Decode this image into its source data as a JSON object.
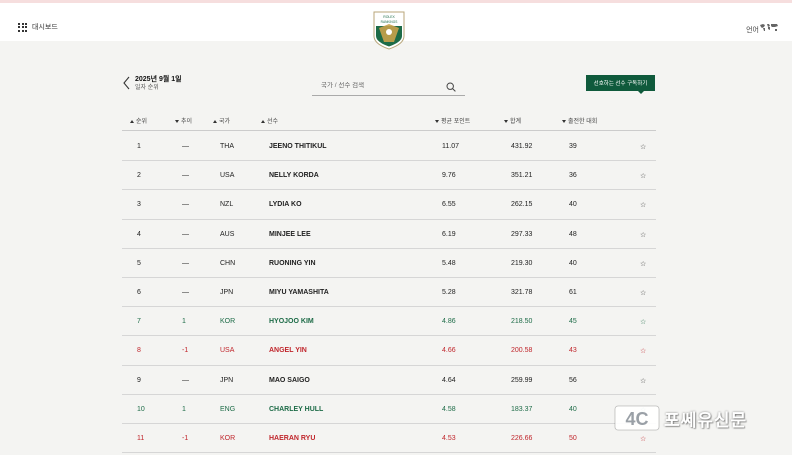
{
  "header": {
    "dashboard_label": "대시보드",
    "logo_lines": [
      "ROLEX",
      "RANKINGS"
    ],
    "language_label": "언어"
  },
  "date": {
    "date_text": "2025년 9월 1일",
    "subtitle": "일자 순위"
  },
  "search": {
    "placeholder": "국가 / 선수 검색"
  },
  "subscribe_label": "선호하는 선수 구독하기",
  "columns": [
    {
      "label": "순위",
      "sort": "up"
    },
    {
      "label": "추이",
      "sort": "down"
    },
    {
      "label": "국가",
      "sort": "up"
    },
    {
      "label": "선수",
      "sort": "up"
    },
    {
      "label": "평균 포인트",
      "sort": "down"
    },
    {
      "label": "합계",
      "sort": "down"
    },
    {
      "label": "출전한 대회",
      "sort": "down"
    }
  ],
  "rows": [
    {
      "rank": "1",
      "trend": "—",
      "country": "THA",
      "player": "JEENO THITIKUL",
      "avg": "11.07",
      "total": "431.92",
      "events": "39",
      "status": "same"
    },
    {
      "rank": "2",
      "trend": "—",
      "country": "USA",
      "player": "NELLY KORDA",
      "avg": "9.76",
      "total": "351.21",
      "events": "36",
      "status": "same"
    },
    {
      "rank": "3",
      "trend": "—",
      "country": "NZL",
      "player": "LYDIA KO",
      "avg": "6.55",
      "total": "262.15",
      "events": "40",
      "status": "same"
    },
    {
      "rank": "4",
      "trend": "—",
      "country": "AUS",
      "player": "MINJEE LEE",
      "avg": "6.19",
      "total": "297.33",
      "events": "48",
      "status": "same"
    },
    {
      "rank": "5",
      "trend": "—",
      "country": "CHN",
      "player": "RUONING YIN",
      "avg": "5.48",
      "total": "219.30",
      "events": "40",
      "status": "same"
    },
    {
      "rank": "6",
      "trend": "—",
      "country": "JPN",
      "player": "MIYU YAMASHITA",
      "avg": "5.28",
      "total": "321.78",
      "events": "61",
      "status": "same"
    },
    {
      "rank": "7",
      "trend": "1",
      "country": "KOR",
      "player": "HYOJOO KIM",
      "avg": "4.86",
      "total": "218.50",
      "events": "45",
      "status": "up"
    },
    {
      "rank": "8",
      "trend": "-1",
      "country": "USA",
      "player": "ANGEL YIN",
      "avg": "4.66",
      "total": "200.58",
      "events": "43",
      "status": "down"
    },
    {
      "rank": "9",
      "trend": "—",
      "country": "JPN",
      "player": "MAO SAIGO",
      "avg": "4.64",
      "total": "259.99",
      "events": "56",
      "status": "same"
    },
    {
      "rank": "10",
      "trend": "1",
      "country": "ENG",
      "player": "CHARLEY HULL",
      "avg": "4.58",
      "total": "183.37",
      "events": "40",
      "status": "up"
    },
    {
      "rank": "11",
      "trend": "-1",
      "country": "KOR",
      "player": "HAERAN RYU",
      "avg": "4.53",
      "total": "226.66",
      "events": "50",
      "status": "down"
    }
  ],
  "star_symbol": "☆",
  "watermark": {
    "logo_text": "4C",
    "text": "포쎄유신문"
  },
  "colors": {
    "accent_green": "#0f5a3c",
    "up": "#1d6b47",
    "down": "#c0262c"
  }
}
